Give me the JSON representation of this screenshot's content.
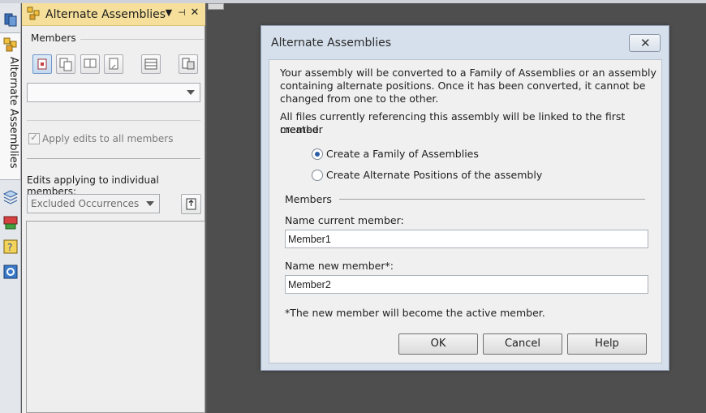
{
  "panel": {
    "title": "Alternate Assemblies",
    "vertical_tab_label": "Alternate Assemblies",
    "members_label": "Members",
    "member_select_value": "",
    "apply_edits_label": "Apply edits to all members",
    "apply_edits_checked": true,
    "edits_individual_label": "Edits applying to individual members:",
    "edits_filter_value": "Excluded Occurrences"
  },
  "dialog": {
    "title": "Alternate Assemblies",
    "paragraph1_line1": "Your assembly will be converted to a Family of Assemblies or an assembly",
    "paragraph1_line2": "containing alternate positions. Once it has been converted, it cannot be",
    "paragraph1_line3": "changed from one to the other.",
    "paragraph2_line1": "All files currently referencing this assembly will be linked to the first member",
    "paragraph2_line2": "created.",
    "radio_family_label": "Create a Family of Assemblies",
    "radio_positions_label": "Create Alternate Positions of the assembly",
    "selected_option": "Create a Family of Assemblies",
    "members_group_label": "Members",
    "current_member_label": "Name current member:",
    "current_member_value": "Member1",
    "new_member_label": "Name new member*:",
    "new_member_value": "Member2",
    "footnote": "*The new member will become the active member.",
    "ok_label": "OK",
    "cancel_label": "Cancel",
    "help_label": "Help"
  },
  "colors": {
    "panel_header": "#f5df9a",
    "dialog_frame": "#d6e0ec",
    "workspace": "#4e4e4e"
  }
}
